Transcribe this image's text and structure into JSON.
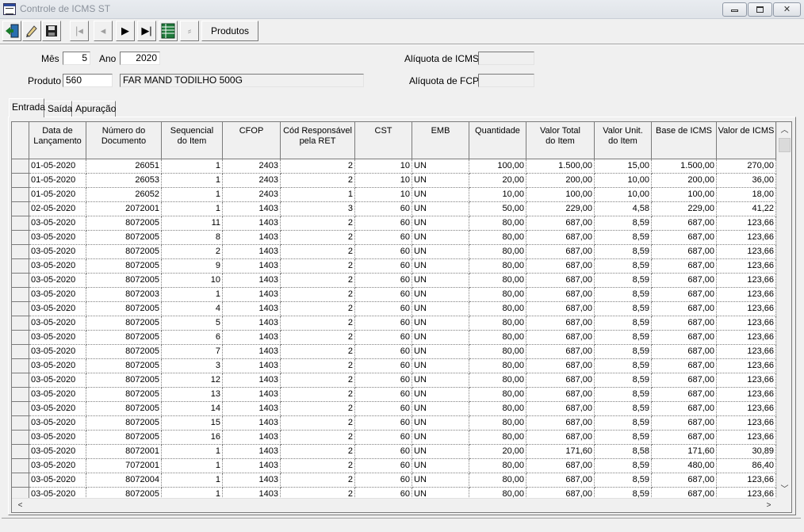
{
  "window": {
    "title": "Controle de ICMS ST"
  },
  "toolbar": {
    "produtos_label": "Produtos"
  },
  "form": {
    "mes_label": "Mês",
    "mes_value": "5",
    "ano_label": "Ano",
    "ano_value": "2020",
    "produto_label": "Produto",
    "produto_code": "560",
    "produto_desc": "FAR MAND TODILHO 500G",
    "aliq_icms_label": "Alíquota de ICMS",
    "aliq_icms_value": "",
    "aliq_fcp_label": "Alíquota de FCP",
    "aliq_fcp_value": ""
  },
  "tabs": [
    {
      "label": "Entrada",
      "active": true
    },
    {
      "label": "Saída",
      "active": false
    },
    {
      "label": "Apuração",
      "active": false
    }
  ],
  "grid": {
    "headers": [
      "Data de\nLançamento",
      "Número do\nDocumento",
      "Sequencial\ndo Item",
      "CFOP",
      "Cód Responsável\npela RET",
      "CST",
      "EMB",
      "Quantidade",
      "Valor Total\ndo Item",
      "Valor Unit.\ndo Item",
      "Base de ICMS",
      "Valor de ICMS"
    ],
    "rows": [
      [
        "01-05-2020",
        "26051",
        "1",
        "2403",
        "2",
        "10",
        "UN",
        "100,00",
        "1.500,00",
        "15,00",
        "1.500,00",
        "270,00"
      ],
      [
        "01-05-2020",
        "26053",
        "1",
        "2403",
        "2",
        "10",
        "UN",
        "20,00",
        "200,00",
        "10,00",
        "200,00",
        "36,00"
      ],
      [
        "01-05-2020",
        "26052",
        "1",
        "2403",
        "1",
        "10",
        "UN",
        "10,00",
        "100,00",
        "10,00",
        "100,00",
        "18,00"
      ],
      [
        "02-05-2020",
        "2072001",
        "1",
        "1403",
        "3",
        "60",
        "UN",
        "50,00",
        "229,00",
        "4,58",
        "229,00",
        "41,22"
      ],
      [
        "03-05-2020",
        "8072005",
        "11",
        "1403",
        "2",
        "60",
        "UN",
        "80,00",
        "687,00",
        "8,59",
        "687,00",
        "123,66"
      ],
      [
        "03-05-2020",
        "8072005",
        "8",
        "1403",
        "2",
        "60",
        "UN",
        "80,00",
        "687,00",
        "8,59",
        "687,00",
        "123,66"
      ],
      [
        "03-05-2020",
        "8072005",
        "2",
        "1403",
        "2",
        "60",
        "UN",
        "80,00",
        "687,00",
        "8,59",
        "687,00",
        "123,66"
      ],
      [
        "03-05-2020",
        "8072005",
        "9",
        "1403",
        "2",
        "60",
        "UN",
        "80,00",
        "687,00",
        "8,59",
        "687,00",
        "123,66"
      ],
      [
        "03-05-2020",
        "8072005",
        "10",
        "1403",
        "2",
        "60",
        "UN",
        "80,00",
        "687,00",
        "8,59",
        "687,00",
        "123,66"
      ],
      [
        "03-05-2020",
        "8072003",
        "1",
        "1403",
        "2",
        "60",
        "UN",
        "80,00",
        "687,00",
        "8,59",
        "687,00",
        "123,66"
      ],
      [
        "03-05-2020",
        "8072005",
        "4",
        "1403",
        "2",
        "60",
        "UN",
        "80,00",
        "687,00",
        "8,59",
        "687,00",
        "123,66"
      ],
      [
        "03-05-2020",
        "8072005",
        "5",
        "1403",
        "2",
        "60",
        "UN",
        "80,00",
        "687,00",
        "8,59",
        "687,00",
        "123,66"
      ],
      [
        "03-05-2020",
        "8072005",
        "6",
        "1403",
        "2",
        "60",
        "UN",
        "80,00",
        "687,00",
        "8,59",
        "687,00",
        "123,66"
      ],
      [
        "03-05-2020",
        "8072005",
        "7",
        "1403",
        "2",
        "60",
        "UN",
        "80,00",
        "687,00",
        "8,59",
        "687,00",
        "123,66"
      ],
      [
        "03-05-2020",
        "8072005",
        "3",
        "1403",
        "2",
        "60",
        "UN",
        "80,00",
        "687,00",
        "8,59",
        "687,00",
        "123,66"
      ],
      [
        "03-05-2020",
        "8072005",
        "12",
        "1403",
        "2",
        "60",
        "UN",
        "80,00",
        "687,00",
        "8,59",
        "687,00",
        "123,66"
      ],
      [
        "03-05-2020",
        "8072005",
        "13",
        "1403",
        "2",
        "60",
        "UN",
        "80,00",
        "687,00",
        "8,59",
        "687,00",
        "123,66"
      ],
      [
        "03-05-2020",
        "8072005",
        "14",
        "1403",
        "2",
        "60",
        "UN",
        "80,00",
        "687,00",
        "8,59",
        "687,00",
        "123,66"
      ],
      [
        "03-05-2020",
        "8072005",
        "15",
        "1403",
        "2",
        "60",
        "UN",
        "80,00",
        "687,00",
        "8,59",
        "687,00",
        "123,66"
      ],
      [
        "03-05-2020",
        "8072005",
        "16",
        "1403",
        "2",
        "60",
        "UN",
        "80,00",
        "687,00",
        "8,59",
        "687,00",
        "123,66"
      ],
      [
        "03-05-2020",
        "8072001",
        "1",
        "1403",
        "2",
        "60",
        "UN",
        "20,00",
        "171,60",
        "8,58",
        "171,60",
        "30,89"
      ],
      [
        "03-05-2020",
        "7072001",
        "1",
        "1403",
        "2",
        "60",
        "UN",
        "80,00",
        "687,00",
        "8,59",
        "480,00",
        "86,40"
      ],
      [
        "03-05-2020",
        "8072004",
        "1",
        "1403",
        "2",
        "60",
        "UN",
        "80,00",
        "687,00",
        "8,59",
        "687,00",
        "123,66"
      ],
      [
        "03-05-2020",
        "8072005",
        "1",
        "1403",
        "2",
        "60",
        "UN",
        "80,00",
        "687,00",
        "8,59",
        "687,00",
        "123,66"
      ]
    ]
  }
}
